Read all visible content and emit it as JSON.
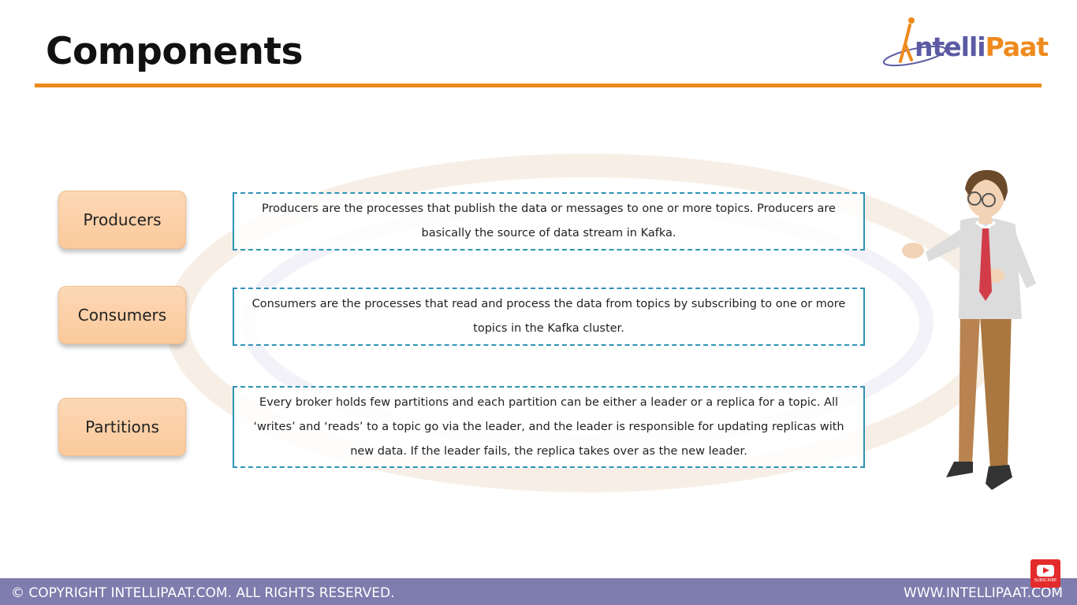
{
  "header": {
    "title": "Components",
    "logo": {
      "part1": "ntelli",
      "part2": "Paat",
      "prefix": "I"
    }
  },
  "items": [
    {
      "label": "Producers",
      "description": "Producers are the processes that publish the data or messages to one or more topics. Producers are basically the source of data stream in Kafka."
    },
    {
      "label": "Consumers",
      "description": "Consumers are the processes that read and process the data from topics by subscribing to one or more topics in the Kafka cluster."
    },
    {
      "label": "Partitions",
      "description": "Every broker holds few partitions and each partition can be either a leader or a replica for a topic. All ‘writes’ and ‘reads’ to a topic go via the leader, and the leader is responsible for updating replicas with new data. If the leader fails, the replica takes over as the new leader."
    }
  ],
  "footer": {
    "copyright": "© COPYRIGHT  INTELLIPAAT.COM. ALL RIGHTS RESERVED.",
    "website": "WWW.INTELLIPAAT.COM"
  },
  "subscribe": {
    "label": "SUBSCRIBE"
  },
  "colors": {
    "accent": "#ee8a1c",
    "box_border": "#2f93b6",
    "footer_bg": "#7f7cae",
    "label_bg": "#fbc99b"
  }
}
